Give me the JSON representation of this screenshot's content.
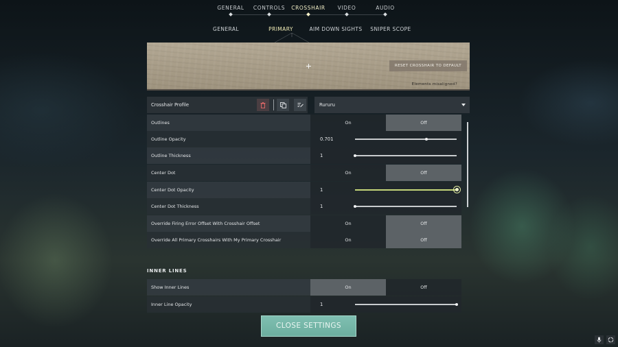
{
  "top_tabs": [
    {
      "label": "GENERAL",
      "active": false
    },
    {
      "label": "CONTROLS",
      "active": false
    },
    {
      "label": "CROSSHAIR",
      "active": true
    },
    {
      "label": "VIDEO",
      "active": false
    },
    {
      "label": "AUDIO",
      "active": false
    }
  ],
  "sub_tabs": [
    {
      "label": "GENERAL",
      "active": false
    },
    {
      "label": "PRIMARY",
      "active": true
    },
    {
      "label": "AIM DOWN SIGHTS",
      "active": false
    },
    {
      "label": "SNIPER SCOPE",
      "active": false
    }
  ],
  "preview": {
    "reset_label": "RESET CROSSHAIR TO DEFAULT",
    "misaligned_label": "Elements misaligned?"
  },
  "profile": {
    "label": "Crosshair Profile",
    "selected": "Rururu",
    "icons": [
      "trash-icon",
      "copy-icon",
      "rename-icon"
    ]
  },
  "toggle_labels": {
    "on": "On",
    "off": "Off"
  },
  "settings": [
    {
      "label": "Outlines",
      "type": "toggle",
      "value": "off"
    },
    {
      "label": "Outline Opacity",
      "type": "slider",
      "display": "0.701",
      "value": 0.701
    },
    {
      "label": "Outline Thickness",
      "type": "slider",
      "display": "1",
      "value": 0.0
    },
    {
      "label": "Center Dot",
      "type": "toggle",
      "value": "off"
    },
    {
      "label": "Center Dot Opacity",
      "type": "slider",
      "display": "1",
      "value": 1.0,
      "active": true
    },
    {
      "label": "Center Dot Thickness",
      "type": "slider",
      "display": "1",
      "value": 0.0
    },
    {
      "label": "Override Firing Error Offset With Crosshair Offset",
      "type": "toggle",
      "value": "off"
    },
    {
      "label": "Override All Primary Crosshairs With My Primary Crosshair",
      "type": "toggle",
      "value": "off"
    }
  ],
  "inner_lines": {
    "title": "INNER LINES",
    "settings": [
      {
        "label": "Show Inner Lines",
        "type": "toggle",
        "value": "on"
      },
      {
        "label": "Inner Line Opacity",
        "type": "slider",
        "display": "1",
        "value": 1.0
      }
    ]
  },
  "close_label": "CLOSE SETTINGS",
  "corner_icons": [
    "microphone-icon",
    "settings-ring-icon"
  ],
  "colors": {
    "accent": "#6cae9f",
    "active_tab": "#f4f0c8",
    "slider_active": "#c5d67a"
  }
}
